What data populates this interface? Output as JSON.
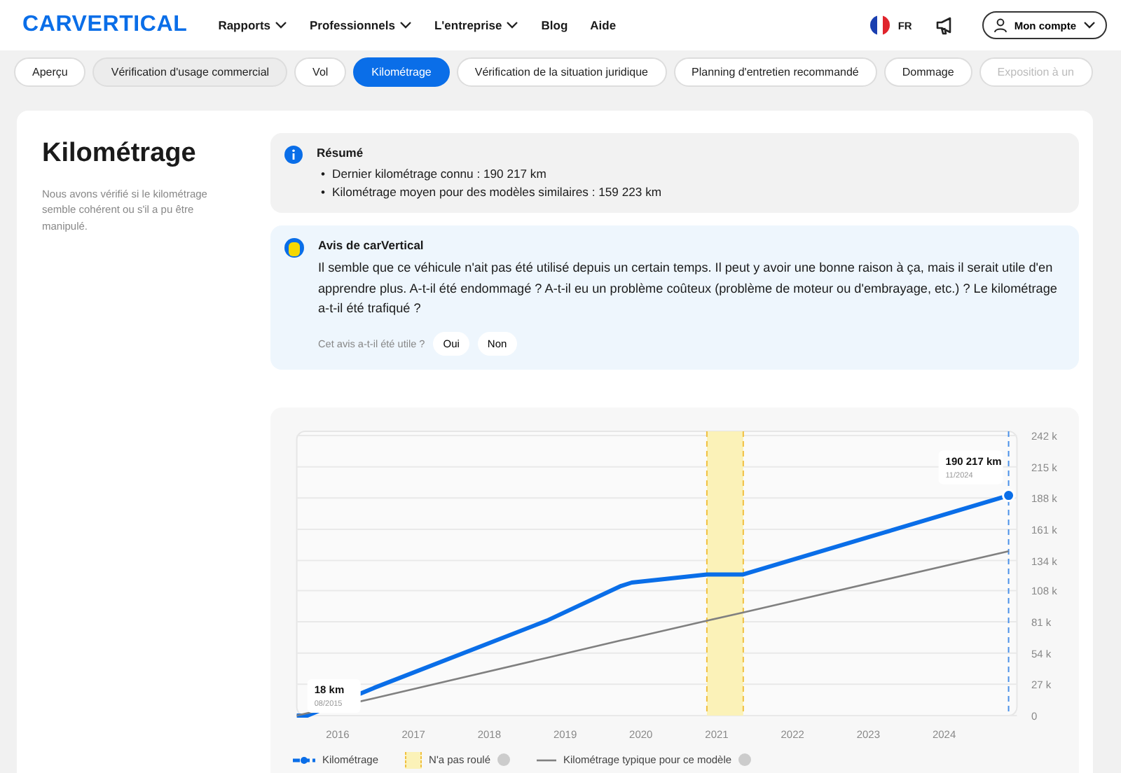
{
  "header": {
    "logo": "CARVERTICAL",
    "nav": [
      {
        "label": "Rapports",
        "dropdown": true
      },
      {
        "label": "Professionnels",
        "dropdown": true
      },
      {
        "label": "L'entreprise",
        "dropdown": true
      },
      {
        "label": "Blog",
        "dropdown": false
      },
      {
        "label": "Aide",
        "dropdown": false
      }
    ],
    "language": "FR",
    "account": "Mon compte"
  },
  "tabs": [
    {
      "label": "Aperçu",
      "selected": false,
      "hovered": false
    },
    {
      "label": "Vérification d'usage commercial",
      "selected": false,
      "hovered": true
    },
    {
      "label": "Vol",
      "selected": false,
      "hovered": false
    },
    {
      "label": "Kilométrage",
      "selected": true,
      "hovered": false
    },
    {
      "label": "Vérification de la situation juridique",
      "selected": false,
      "hovered": false
    },
    {
      "label": "Planning d'entretien recommandé",
      "selected": false,
      "hovered": false
    },
    {
      "label": "Dommage",
      "selected": false,
      "hovered": false
    },
    {
      "label": "Exposition à un",
      "selected": false,
      "hovered": false
    }
  ],
  "section": {
    "title": "Kilométrage",
    "description": "Nous avons vérifié si le kilométrage semble cohérent ou s'il a pu être manipulé.",
    "summary": {
      "title": "Résumé",
      "marker": "•",
      "items": [
        "Dernier kilométrage connu : 190 217 km",
        "Kilométrage moyen pour des modèles similaires : 159 223 km"
      ]
    },
    "opinion": {
      "title": "Avis de carVertical",
      "text": "Il semble que ce véhicule n'ait pas été utilisé depuis un certain temps. Il peut y avoir une bonne raison à ça, mais il serait utile d'en apprendre plus. A-t-il été endommagé ? A-t-il eu un problème coûteux (problème de moteur ou d'embrayage, etc.) ? Le kilométrage a-t-il été trafiqué ?",
      "feedback_prompt": "Cet avis a-t-il été utile ?",
      "buttons": [
        "Oui",
        "Non"
      ]
    },
    "chart": {
      "legend_help": [
        false,
        true,
        true
      ],
      "chart_data": {
        "type": "line",
        "grid": true,
        "xlim": [
          2015.46,
          2024.96
        ],
        "x": [
          2015.46,
          2015.6,
          2016.48,
          2018.76,
          2019.74,
          2019.88,
          2020.87,
          2021.35,
          2024.85
        ],
        "series": [
          {
            "name": "Kilométrage",
            "color": "#0a6ee8",
            "values": [
              0,
              18,
              24000,
              82000,
              112000,
              115000,
              122000,
              122000,
              190217
            ]
          },
          {
            "name": "Kilométrage typique pour ce modèle",
            "color": "#808080",
            "values": [
              0,
              2000,
              15000,
              50000,
              65000,
              67000,
              82000,
              89000,
              142000
            ]
          }
        ],
        "ylim": [
          0,
          242000
        ],
        "xticks": [
          {
            "value": 2016,
            "label": "2016"
          },
          {
            "value": 2017,
            "label": "2017"
          },
          {
            "value": 2018,
            "label": "2018"
          },
          {
            "value": 2019,
            "label": "2019"
          },
          {
            "value": 2020,
            "label": "2020"
          },
          {
            "value": 2021,
            "label": "2021"
          },
          {
            "value": 2022,
            "label": "2022"
          },
          {
            "value": 2023,
            "label": "2023"
          },
          {
            "value": 2024,
            "label": "2024"
          }
        ],
        "yticks": [
          {
            "value": 0,
            "label": "0"
          },
          {
            "value": 27000,
            "label": "27 k"
          },
          {
            "value": 54000,
            "label": "54 k"
          },
          {
            "value": 81000,
            "label": "81 k"
          },
          {
            "value": 108000,
            "label": "108 k"
          },
          {
            "value": 134000,
            "label": "134 k"
          },
          {
            "value": 161000,
            "label": "161 k"
          },
          {
            "value": 188000,
            "label": "188 k"
          },
          {
            "value": 215000,
            "label": "215 k"
          },
          {
            "value": 242000,
            "label": "242 k"
          }
        ],
        "bands": [
          {
            "axis": "x",
            "from": 2020.87,
            "to": 2021.35,
            "label": "N'a pas roulé"
          }
        ],
        "ref_lines": [
          {
            "axis": "x",
            "value": 2020.87,
            "color": "#f0c040"
          },
          {
            "axis": "x",
            "value": 2021.35,
            "color": "#f0c040"
          },
          {
            "axis": "x",
            "value": 2024.85,
            "color": "#4a90e8"
          }
        ],
        "annotations": [
          {
            "x": 2015.6,
            "y": 18,
            "text": "18 km"
          },
          "08/2015",
          {
            "x": 2024.85,
            "y": 190217,
            "text": "190 217 km"
          },
          "11/2024"
        ]
      }
    }
  }
}
